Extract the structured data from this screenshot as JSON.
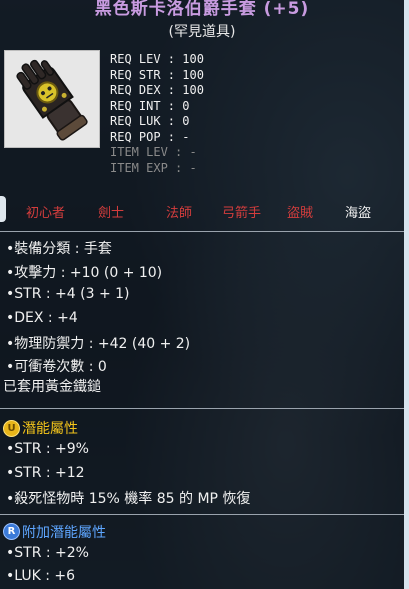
{
  "item": {
    "title": "黑色斯卡洛伯爵手套 (+5)",
    "rarity": "(罕見道具)",
    "icon": "glove-icon"
  },
  "requirements": [
    {
      "label": "REQ LEV",
      "value": "100",
      "dim": false
    },
    {
      "label": "REQ STR",
      "value": "100",
      "dim": false
    },
    {
      "label": "REQ DEX",
      "value": "100",
      "dim": false
    },
    {
      "label": "REQ INT",
      "value": "0",
      "dim": false
    },
    {
      "label": "REQ LUK",
      "value": "0",
      "dim": false
    },
    {
      "label": "REQ POP",
      "value": "-",
      "dim": false
    },
    {
      "label": "ITEM LEV",
      "value": "-",
      "dim": true
    },
    {
      "label": "ITEM EXP",
      "value": "-",
      "dim": true
    }
  ],
  "jobs": [
    {
      "name": "初心者",
      "active": false
    },
    {
      "name": "劍士",
      "active": false
    },
    {
      "name": "法師",
      "active": false
    },
    {
      "name": "弓箭手",
      "active": false
    },
    {
      "name": "盜賊",
      "active": false
    },
    {
      "name": "海盜",
      "active": true
    }
  ],
  "stats": [
    "•裝備分類 : 手套",
    "•攻擊力 : +10 (0 + 10)",
    "•STR : +4 (3 + 1)",
    "•DEX : +4",
    "•物理防禦力 : +42 (40 + 2)",
    "•可衝卷次數 : 0"
  ],
  "gold_hammer_text": "已套用黃金鐵鎚",
  "potential": {
    "label": "潛能屬性",
    "badge": "U",
    "lines": [
      "•STR : +9%",
      "•STR : +12",
      "•殺死怪物時 15% 機率 85 的 MP 恢復"
    ]
  },
  "bonus_potential": {
    "label": "附加潛能屬性",
    "badge": "R",
    "lines": [
      "•STR : +2%",
      "•LUK : +6"
    ]
  },
  "colors": {
    "title": "#c89be0",
    "job_locked": "#d43d3d",
    "potential_label": "#f2c31a",
    "bonus_label": "#5ea6ff"
  }
}
